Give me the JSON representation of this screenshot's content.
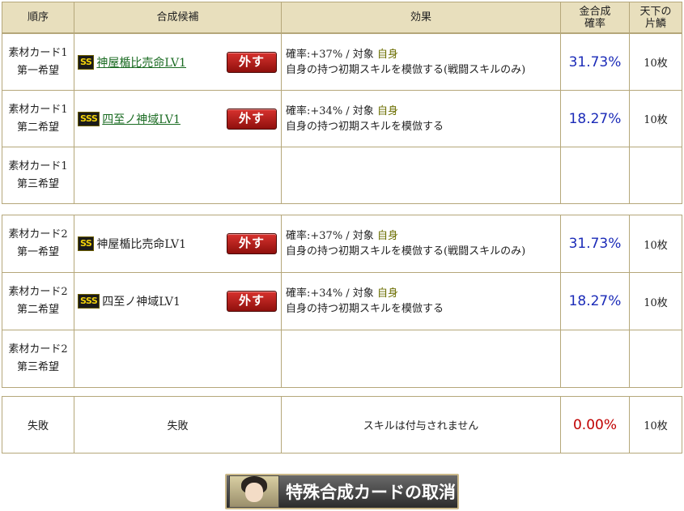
{
  "headers": {
    "order": "順序",
    "candidate": "合成候補",
    "effect": "効果",
    "rate_line1": "金合成",
    "rate_line2": "確率",
    "scale_line1": "天下の",
    "scale_line2": "片鱗"
  },
  "remove_label": "外す",
  "groups": [
    {
      "rows": [
        {
          "order_line1": "素材カード1",
          "order_line2": "第一希望",
          "rank": "SS",
          "name": "神屋楯比売命LV1",
          "linked": true,
          "effect_prefix": "確率:+37%  /  対象",
          "effect_target": "自身",
          "effect_desc": "自身の持つ初期スキルを模倣する(戦闘スキルのみ)",
          "rate": "31.73%",
          "scale": "10枚"
        },
        {
          "order_line1": "素材カード1",
          "order_line2": "第二希望",
          "rank": "SSS",
          "name": "四至ノ神域LV1",
          "linked": true,
          "effect_prefix": "確率:+34%  /  対象",
          "effect_target": "自身",
          "effect_desc": "自身の持つ初期スキルを模倣する",
          "rate": "18.27%",
          "scale": "10枚"
        },
        {
          "order_line1": "素材カード1",
          "order_line2": "第三希望",
          "empty": true
        }
      ]
    },
    {
      "rows": [
        {
          "order_line1": "素材カード2",
          "order_line2": "第一希望",
          "rank": "SS",
          "name": "神屋楯比売命LV1",
          "linked": false,
          "effect_prefix": "確率:+37%  /  対象",
          "effect_target": "自身",
          "effect_desc": "自身の持つ初期スキルを模倣する(戦闘スキルのみ)",
          "rate": "31.73%",
          "scale": "10枚"
        },
        {
          "order_line1": "素材カード2",
          "order_line2": "第二希望",
          "rank": "SSS",
          "name": "四至ノ神域LV1",
          "linked": false,
          "effect_prefix": "確率:+34%  /  対象",
          "effect_target": "自身",
          "effect_desc": "自身の持つ初期スキルを模倣する",
          "rate": "18.27%",
          "scale": "10枚"
        },
        {
          "order_line1": "素材カード2",
          "order_line2": "第三希望",
          "empty": true
        }
      ]
    }
  ],
  "failure": {
    "order": "失敗",
    "candidate": "失敗",
    "effect": "スキルは付与されません",
    "rate": "0.00%",
    "scale": "10枚"
  },
  "cancel_button_label": "特殊合成カードの取消",
  "colors": {
    "header_bg": "#e8dfbd",
    "border": "#b5a77a",
    "rate_blue": "#1b2bb8",
    "rate_red": "#c00000",
    "link_green": "#1a6b22",
    "remove_red": "#c8201c"
  }
}
